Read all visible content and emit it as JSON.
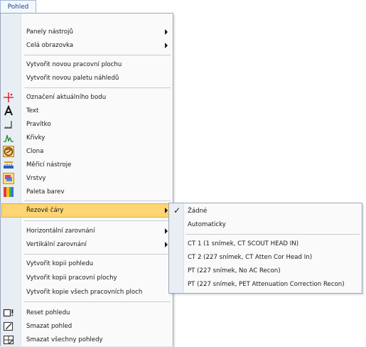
{
  "menubar": {
    "title": "Pohled"
  },
  "main_menu": {
    "items": [
      {
        "label": "Panely nástrojů",
        "submenu": true
      },
      {
        "label": "Celá obrazovka",
        "submenu": true
      },
      {
        "label": "Vytvořit novou pracovní plochu"
      },
      {
        "label": "Vytvořit novou paletu náhledů"
      },
      {
        "label": "Označení aktuálního bodu",
        "icon": "crosshair-icon"
      },
      {
        "label": "Text",
        "icon": "text-icon"
      },
      {
        "label": "Pravítko",
        "icon": "ruler-icon"
      },
      {
        "label": "Křivky",
        "icon": "curves-icon"
      },
      {
        "label": "Clona",
        "icon": "aperture-icon"
      },
      {
        "label": "Měřicí nástroje",
        "icon": "measure-tools-icon"
      },
      {
        "label": "Vrstvy",
        "icon": "layers-icon"
      },
      {
        "label": "Paleta barev",
        "icon": "color-palette-icon"
      },
      {
        "label": "Řezové čáry",
        "submenu": true,
        "highlighted": true
      },
      {
        "label": "Horizontální zarovnání",
        "submenu": true
      },
      {
        "label": "Vertikální zarovnání",
        "submenu": true
      },
      {
        "label": "Vytvořit kopii pohledu"
      },
      {
        "label": "Vytvořit kopii pracovní plochy"
      },
      {
        "label": "Vytvořit kopie všech pracovních ploch"
      },
      {
        "label": "Reset pohledu",
        "icon": "reset-view-icon"
      },
      {
        "label": "Smazat pohled",
        "icon": "delete-view-icon"
      },
      {
        "label": "Smazat všechny pohledy",
        "icon": "delete-all-views-icon"
      }
    ]
  },
  "sub_menu": {
    "items": [
      {
        "label": "Žádné",
        "checked": true
      },
      {
        "label": "Automaticky"
      },
      {
        "label": "CT 1 (1 snímek, CT SCOUT HEAD IN)"
      },
      {
        "label": "CT 2 (227 snímek, CT Atten Cor Head In)"
      },
      {
        "label": "PT (227 snímek, No AC Recon)"
      },
      {
        "label": "PT (227 snímek, PET Attenuation Correction Recon)"
      }
    ],
    "check_glyph": "✓"
  },
  "colors": {
    "highlight": "#fdd574",
    "highlight_border": "#e4a93b",
    "gutter": "#e9eef5",
    "menubar_text": "#15428b"
  }
}
